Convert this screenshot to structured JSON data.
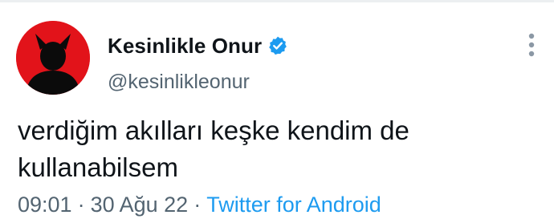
{
  "tweet": {
    "author": {
      "display_name": "Kesinlikle Onur",
      "handle": "@kesinlikleonur",
      "verified": true,
      "avatar_icon": "devil-silhouette-avatar",
      "avatar_color": "#e2131a"
    },
    "text": "verdiğim akılları keşke kendim de kullanabilsem",
    "time": "09:01",
    "date": "30 Ağu 22",
    "separator": "·",
    "source": "Twitter for Android",
    "more_icon": "more-vertical-icon"
  },
  "colors": {
    "accent": "#1d9bf0",
    "text": "#0f1419",
    "muted": "#536471"
  }
}
